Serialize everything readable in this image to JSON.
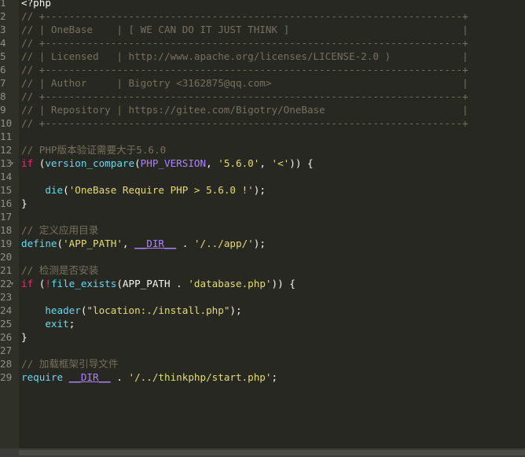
{
  "lines": [
    {
      "n": "1",
      "tokens": [
        {
          "t": "plain",
          "v": "<?php"
        }
      ]
    },
    {
      "n": "2",
      "tokens": [
        {
          "t": "comment",
          "v": "// +----------------------------------------------------------------------+"
        }
      ]
    },
    {
      "n": "3",
      "tokens": [
        {
          "t": "comment",
          "v": "// | OneBase    | [ WE CAN DO IT JUST THINK ]                             |"
        }
      ]
    },
    {
      "n": "4",
      "tokens": [
        {
          "t": "comment",
          "v": "// +----------------------------------------------------------------------+"
        }
      ]
    },
    {
      "n": "5",
      "tokens": [
        {
          "t": "comment",
          "v": "// | Licensed   | http://www.apache.org/licenses/LICENSE-2.0 )            |"
        }
      ]
    },
    {
      "n": "6",
      "tokens": [
        {
          "t": "comment",
          "v": "// +----------------------------------------------------------------------+"
        }
      ]
    },
    {
      "n": "7",
      "tokens": [
        {
          "t": "comment",
          "v": "// | Author     | Bigotry <3162875@qq.com>                                |"
        }
      ]
    },
    {
      "n": "8",
      "tokens": [
        {
          "t": "comment",
          "v": "// +----------------------------------------------------------------------+"
        }
      ]
    },
    {
      "n": "9",
      "tokens": [
        {
          "t": "comment",
          "v": "// | Repository | https://gitee.com/Bigotry/OneBase                       |"
        }
      ]
    },
    {
      "n": "10",
      "tokens": [
        {
          "t": "comment",
          "v": "// +----------------------------------------------------------------------+"
        }
      ]
    },
    {
      "n": "11",
      "tokens": []
    },
    {
      "n": "12",
      "tokens": [
        {
          "t": "comment",
          "v": "// PHP版本验证需要大于5.6.0"
        }
      ]
    },
    {
      "n": "13",
      "fold": true,
      "tokens": [
        {
          "t": "keyword",
          "v": "if"
        },
        {
          "t": "plain",
          "v": " ("
        },
        {
          "t": "func",
          "v": "version_compare"
        },
        {
          "t": "plain",
          "v": "("
        },
        {
          "t": "const",
          "v": "PHP_VERSION"
        },
        {
          "t": "plain",
          "v": ", "
        },
        {
          "t": "string",
          "v": "'5.6.0'"
        },
        {
          "t": "plain",
          "v": ", "
        },
        {
          "t": "string",
          "v": "'<'"
        },
        {
          "t": "plain",
          "v": ")) {"
        }
      ]
    },
    {
      "n": "14",
      "tokens": []
    },
    {
      "n": "15",
      "tokens": [
        {
          "t": "plain",
          "v": "    "
        },
        {
          "t": "func",
          "v": "die"
        },
        {
          "t": "plain",
          "v": "("
        },
        {
          "t": "string",
          "v": "'OneBase Require PHP > 5.6.0 !'"
        },
        {
          "t": "plain",
          "v": ");"
        }
      ]
    },
    {
      "n": "16",
      "tokens": [
        {
          "t": "plain",
          "v": "}"
        }
      ]
    },
    {
      "n": "17",
      "tokens": []
    },
    {
      "n": "18",
      "tokens": [
        {
          "t": "comment",
          "v": "// 定义应用目录"
        }
      ]
    },
    {
      "n": "19",
      "tokens": [
        {
          "t": "func",
          "v": "define"
        },
        {
          "t": "plain",
          "v": "("
        },
        {
          "t": "string",
          "v": "'APP_PATH'"
        },
        {
          "t": "plain",
          "v": ", "
        },
        {
          "t": "magic",
          "v": "__DIR__"
        },
        {
          "t": "plain",
          "v": " . "
        },
        {
          "t": "string",
          "v": "'/../app/'"
        },
        {
          "t": "plain",
          "v": ");"
        }
      ]
    },
    {
      "n": "20",
      "tokens": []
    },
    {
      "n": "21",
      "tokens": [
        {
          "t": "comment",
          "v": "// 检测是否安装"
        }
      ]
    },
    {
      "n": "22",
      "fold": true,
      "tokens": [
        {
          "t": "keyword",
          "v": "if"
        },
        {
          "t": "plain",
          "v": " ("
        },
        {
          "t": "keyword",
          "v": "!"
        },
        {
          "t": "func",
          "v": "file_exists"
        },
        {
          "t": "plain",
          "v": "(APP_PATH . "
        },
        {
          "t": "string",
          "v": "'database.php'"
        },
        {
          "t": "plain",
          "v": ")) {"
        }
      ]
    },
    {
      "n": "23",
      "tokens": []
    },
    {
      "n": "24",
      "tokens": [
        {
          "t": "plain",
          "v": "    "
        },
        {
          "t": "func",
          "v": "header"
        },
        {
          "t": "plain",
          "v": "("
        },
        {
          "t": "string",
          "v": "\"location:./install.php\""
        },
        {
          "t": "plain",
          "v": ");"
        }
      ]
    },
    {
      "n": "25",
      "tokens": [
        {
          "t": "plain",
          "v": "    "
        },
        {
          "t": "func",
          "v": "exit"
        },
        {
          "t": "plain",
          "v": ";"
        }
      ]
    },
    {
      "n": "26",
      "tokens": [
        {
          "t": "plain",
          "v": "}"
        }
      ]
    },
    {
      "n": "27",
      "tokens": []
    },
    {
      "n": "28",
      "tokens": [
        {
          "t": "comment",
          "v": "// 加载框架引导文件"
        }
      ]
    },
    {
      "n": "29",
      "tokens": [
        {
          "t": "func",
          "v": "require"
        },
        {
          "t": "plain",
          "v": " "
        },
        {
          "t": "magic",
          "v": "__DIR__"
        },
        {
          "t": "plain",
          "v": " . "
        },
        {
          "t": "string",
          "v": "'/../thinkphp/start.php'"
        },
        {
          "t": "plain",
          "v": ";"
        }
      ]
    }
  ]
}
